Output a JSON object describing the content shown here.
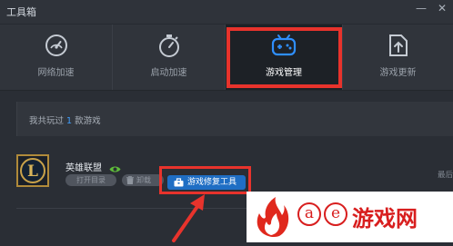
{
  "window": {
    "title": "工具箱",
    "min_symbol": "—",
    "close_symbol": "✕"
  },
  "nav": {
    "items": [
      {
        "label": "网络加速",
        "icon": "speedometer-icon",
        "active": false
      },
      {
        "label": "启动加速",
        "icon": "stopwatch-icon",
        "active": false
      },
      {
        "label": "游戏管理",
        "icon": "gamepad-icon",
        "active": true
      },
      {
        "label": "游戏更新",
        "icon": "file-upload-icon",
        "active": false
      }
    ]
  },
  "summary": {
    "prefix": "我共玩过",
    "count": "1",
    "suffix": "款游戏"
  },
  "game": {
    "name": "英雄联盟",
    "icon_letter": "L",
    "open_dir_label": "打开目录",
    "uninstall_label": "卸载",
    "repair_label": "游戏修复工具",
    "last_label": "最后"
  },
  "watermark": {
    "a": "a",
    "e": "e",
    "text": "游戏网"
  },
  "colors": {
    "highlight": "#e8332c",
    "accent_blue": "#1f6ec4",
    "count_blue": "#3fa0ff",
    "watermark_red": "#d81e1e"
  }
}
